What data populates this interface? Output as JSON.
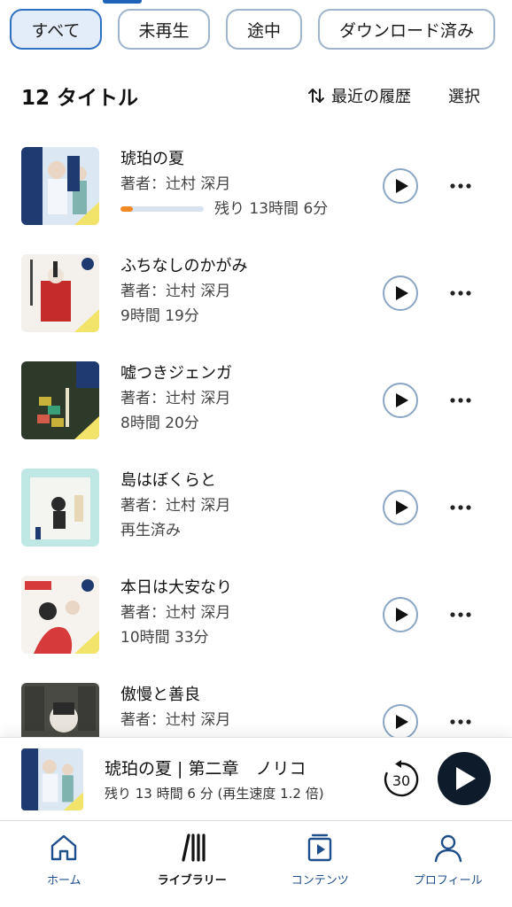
{
  "filters": {
    "chips": [
      "すべて",
      "未再生",
      "途中",
      "ダウンロード済み"
    ],
    "active_index": 0
  },
  "header": {
    "count_title": "12 タイトル",
    "sort_label": "最近の履歴",
    "select_label": "選択"
  },
  "books": [
    {
      "title": "琥珀の夏",
      "author": "著者：辻村 深月",
      "status": "残り 13時間 6分",
      "progress": 0.15,
      "cover_colors": [
        "#dbe7f2",
        "#1e3a6e",
        "#f2e36a"
      ]
    },
    {
      "title": "ふちなしのかがみ",
      "author": "著者：辻村 深月",
      "status": "9時間 19分",
      "cover_colors": [
        "#f4f1ec",
        "#c42b2b",
        "#f2e36a"
      ]
    },
    {
      "title": "嘘つきジェンガ",
      "author": "著者：辻村 深月",
      "status": "8時間 20分",
      "cover_colors": [
        "#2d3a2a",
        "#c9b23a",
        "#f2e36a"
      ]
    },
    {
      "title": "島はぼくらと",
      "author": "著者：辻村 深月",
      "status": "再生済み",
      "cover_colors": [
        "#bfe8e4",
        "#f4f4f0",
        "#2a2a2a"
      ]
    },
    {
      "title": "本日は大安なり",
      "author": "著者：辻村 深月",
      "status": "10時間 33分",
      "cover_colors": [
        "#f6f2ee",
        "#d63a3a",
        "#f2e36a"
      ]
    },
    {
      "title": "傲慢と善良",
      "author": "著者：辻村 深月",
      "status": "",
      "cover_colors": [
        "#4a4a44",
        "#e8e4dc",
        "#2a2a2a"
      ]
    }
  ],
  "mini_player": {
    "title": "琥珀の夏 | 第二章　ノリコ",
    "subtitle": "残り 13 時間 6 分 (再生速度 1.2 倍)",
    "skip_seconds": "30"
  },
  "nav": {
    "items": [
      "ホーム",
      "ライブラリー",
      "コンテンツ",
      "プロフィール"
    ],
    "active_index": 1
  },
  "colors": {
    "accent": "#1f63b8",
    "progress": "#f08a24",
    "chip_active_bg": "#e2edf9"
  }
}
